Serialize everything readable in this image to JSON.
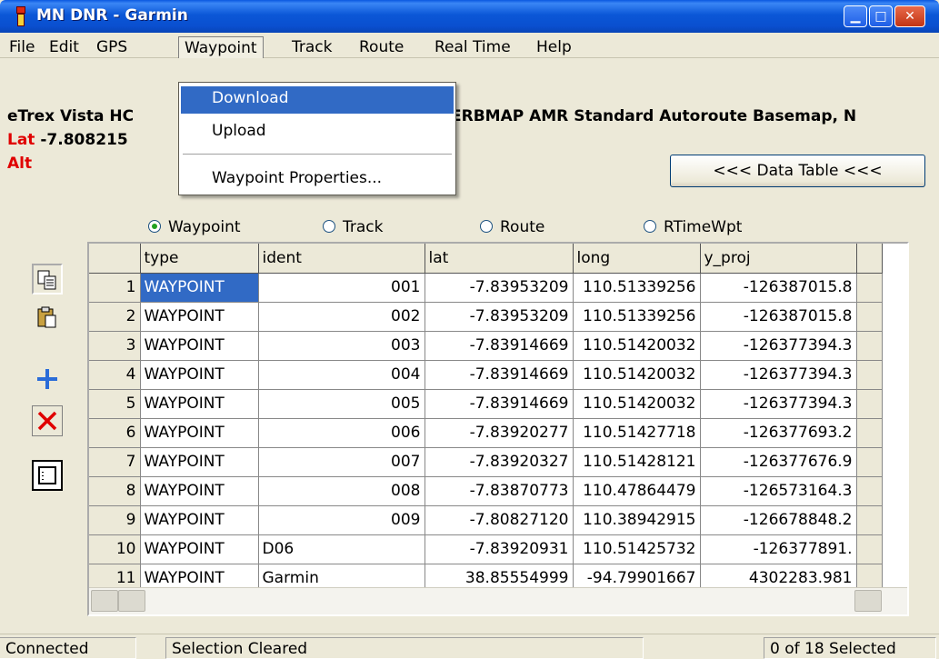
{
  "window": {
    "title": "MN DNR - Garmin"
  },
  "menu": {
    "items": [
      "File",
      "Edit",
      "GPS",
      "Waypoint",
      "Track",
      "Route",
      "Real Time",
      "Help"
    ],
    "active": "Waypoint"
  },
  "waypoint_menu": {
    "items": [
      "Download",
      "Upload",
      "Waypoint Properties..."
    ],
    "highlighted": "Download"
  },
  "device": {
    "info_left": "eTrex Vista HC",
    "info_right": "ERBMAP AMR Standard Autoroute Basemap, N",
    "lat_label": "Lat",
    "lat_value": "-7.808215",
    "alt_label": "Alt"
  },
  "data_table_button": "<<< Data Table <<<",
  "radio_options": [
    {
      "label": "Waypoint",
      "checked": true
    },
    {
      "label": "Track",
      "checked": false
    },
    {
      "label": "Route",
      "checked": false
    },
    {
      "label": "RTimeWpt",
      "checked": false
    }
  ],
  "side_toolbar": {
    "icons": [
      "copy-icon",
      "paste-icon",
      "add-icon",
      "delete-icon",
      "properties-icon"
    ]
  },
  "table": {
    "columns": [
      "type",
      "ident",
      "lat",
      "long",
      "y_proj"
    ],
    "rows": [
      {
        "n": "1",
        "type": "WAYPOINT",
        "ident": "001",
        "lat": "-7.83953209",
        "long": "110.51339256",
        "y_proj": "-126387015.8"
      },
      {
        "n": "2",
        "type": "WAYPOINT",
        "ident": "002",
        "lat": "-7.83953209",
        "long": "110.51339256",
        "y_proj": "-126387015.8"
      },
      {
        "n": "3",
        "type": "WAYPOINT",
        "ident": "003",
        "lat": "-7.83914669",
        "long": "110.51420032",
        "y_proj": "-126377394.3"
      },
      {
        "n": "4",
        "type": "WAYPOINT",
        "ident": "004",
        "lat": "-7.83914669",
        "long": "110.51420032",
        "y_proj": "-126377394.3"
      },
      {
        "n": "5",
        "type": "WAYPOINT",
        "ident": "005",
        "lat": "-7.83914669",
        "long": "110.51420032",
        "y_proj": "-126377394.3"
      },
      {
        "n": "6",
        "type": "WAYPOINT",
        "ident": "006",
        "lat": "-7.83920277",
        "long": "110.51427718",
        "y_proj": "-126377693.2"
      },
      {
        "n": "7",
        "type": "WAYPOINT",
        "ident": "007",
        "lat": "-7.83920327",
        "long": "110.51428121",
        "y_proj": "-126377676.9"
      },
      {
        "n": "8",
        "type": "WAYPOINT",
        "ident": "008",
        "lat": "-7.83870773",
        "long": "110.47864479",
        "y_proj": "-126573164.3"
      },
      {
        "n": "9",
        "type": "WAYPOINT",
        "ident": "009",
        "lat": "-7.80827120",
        "long": "110.38942915",
        "y_proj": "-126678848.2"
      },
      {
        "n": "10",
        "type": "WAYPOINT",
        "ident": "D06",
        "lat": "-7.83920931",
        "long": "110.51425732",
        "y_proj": "-126377891."
      },
      {
        "n": "11",
        "type": "WAYPOINT",
        "ident": "Garmin",
        "lat": "38.85554999",
        "long": "-94.79901667",
        "y_proj": "4302283.981"
      }
    ]
  },
  "status": {
    "connection": "Connected",
    "message": "Selection Cleared",
    "selected": "0 of 18 Selected"
  }
}
